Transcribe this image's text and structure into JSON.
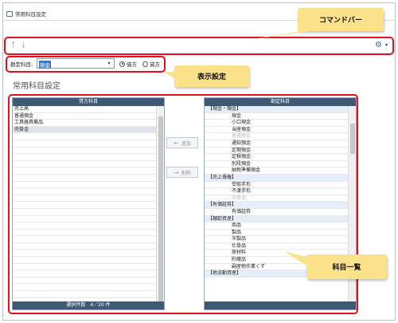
{
  "window": {
    "tab_label": "常用科目設定"
  },
  "command_bar": {
    "up_icon": "↑",
    "down_icon": "↓",
    "gear_icon": "⚙",
    "caret_icon": "▾"
  },
  "settings": {
    "label": "勘定科目:",
    "selected_value": "現金",
    "caret_icon": "▾",
    "radio_debit": "借方",
    "radio_credit": "貸方"
  },
  "page_title": "常用科目設定",
  "left_panel": {
    "header": "貸方科目",
    "rows": [
      "売上高",
      "普通預金",
      "工具器具備品",
      "売掛金"
    ],
    "footer": "選択件数　4／20 件"
  },
  "right_panel": {
    "header": "勘定科目",
    "rows": [
      {
        "text": "【現金・預金】",
        "kind": "grp"
      },
      {
        "text": "現金",
        "kind": "item"
      },
      {
        "text": "小口現金",
        "kind": "item"
      },
      {
        "text": "当座預金",
        "kind": "item"
      },
      {
        "text": "普通預金",
        "kind": "item dim"
      },
      {
        "text": "通知預金",
        "kind": "item"
      },
      {
        "text": "定期預金",
        "kind": "item"
      },
      {
        "text": "定積預金",
        "kind": "item"
      },
      {
        "text": "別段預金",
        "kind": "item"
      },
      {
        "text": "納税準備預金",
        "kind": "item"
      },
      {
        "text": "【売上債権】",
        "kind": "grp"
      },
      {
        "text": "受取手形",
        "kind": "item"
      },
      {
        "text": "不渡手形",
        "kind": "item"
      },
      {
        "text": "売掛金",
        "kind": "item dim"
      },
      {
        "text": "【有価証券】",
        "kind": "grp"
      },
      {
        "text": "有価証券",
        "kind": "item"
      },
      {
        "text": "【棚卸資産】",
        "kind": "grp"
      },
      {
        "text": "商品",
        "kind": "item"
      },
      {
        "text": "製品",
        "kind": "item"
      },
      {
        "text": "半製品",
        "kind": "item"
      },
      {
        "text": "仕掛品",
        "kind": "item"
      },
      {
        "text": "原材料",
        "kind": "item"
      },
      {
        "text": "貯蔵品",
        "kind": "item"
      },
      {
        "text": "副産物作業くず",
        "kind": "item"
      },
      {
        "text": "【他流動資産】",
        "kind": "grp"
      }
    ]
  },
  "buttons": {
    "add_arrow": "←",
    "add_label": "追加",
    "remove_arrow": "→",
    "remove_label": "削除"
  },
  "callouts": {
    "command_bar": "コマンドバー",
    "display_settings": "表示設定",
    "account_list": "科目一覧"
  },
  "colors": {
    "highlight_frame": "#e01020",
    "callout_fill": "#fbe28a",
    "panel_header": "#3f5873",
    "selection": "#3a79c9"
  }
}
